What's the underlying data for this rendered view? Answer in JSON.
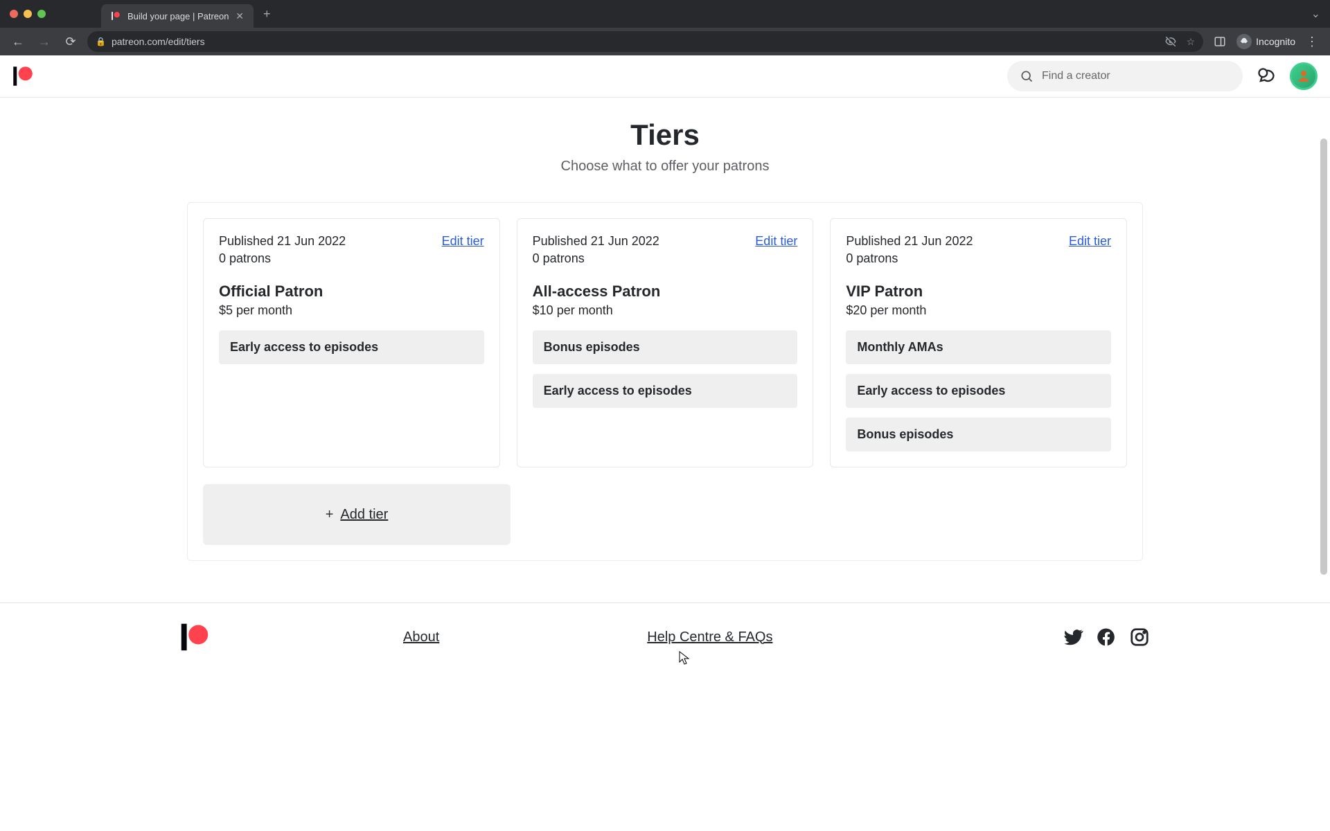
{
  "browser": {
    "tab_title": "Build your page | Patreon",
    "url": "patreon.com/edit/tiers",
    "incognito_label": "Incognito"
  },
  "header": {
    "search_placeholder": "Find a creator"
  },
  "page": {
    "title": "Tiers",
    "subtitle": "Choose what to offer your patrons"
  },
  "tiers": [
    {
      "published": "Published 21 Jun 2022",
      "patrons": "0 patrons",
      "edit_label": "Edit tier",
      "name": "Official Patron",
      "price": "$5 per month",
      "benefits": [
        "Early access to episodes"
      ]
    },
    {
      "published": "Published 21 Jun 2022",
      "patrons": "0 patrons",
      "edit_label": "Edit tier",
      "name": "All-access Patron",
      "price": "$10 per month",
      "benefits": [
        "Bonus episodes",
        "Early access to episodes"
      ]
    },
    {
      "published": "Published 21 Jun 2022",
      "patrons": "0 patrons",
      "edit_label": "Edit tier",
      "name": "VIP Patron",
      "price": "$20 per month",
      "benefits": [
        "Monthly AMAs",
        "Early access to episodes",
        "Bonus episodes"
      ]
    }
  ],
  "add_tier": {
    "plus": "+",
    "label": "Add tier"
  },
  "footer": {
    "links": {
      "about": "About",
      "help": "Help Centre & FAQs"
    }
  }
}
